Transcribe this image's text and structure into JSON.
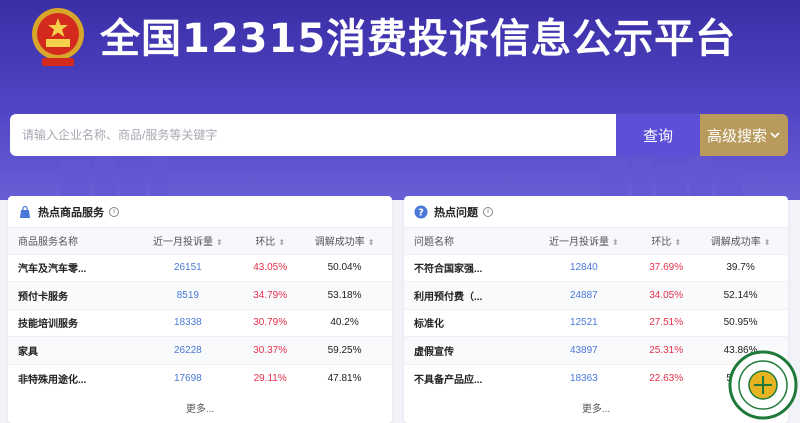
{
  "header": {
    "title": "全国12315消费投诉信息公示平台",
    "emblem_icon": "national-emblem-icon"
  },
  "search": {
    "placeholder": "请输入企业名称、商品/服务等关键字",
    "value": "",
    "search_label": "查询",
    "advanced_label": "高级搜索",
    "advanced_icon": "chevron-down-icon"
  },
  "colors": {
    "hero": "#4a3fbc",
    "search_button": "#5c4fd8",
    "advanced_button": "#b89a5c",
    "count": "#4a78d8",
    "ratio": "#e8304a"
  },
  "hot_goods": {
    "title": "热点商品服务",
    "icon": "shopping-bag-icon",
    "columns": [
      "商品服务名称",
      "近一月投诉量",
      "环比",
      "调解成功率"
    ],
    "rows": [
      {
        "name": "汽车及汽车零...",
        "count": "26151",
        "ratio": "43.05%",
        "rate": "50.04%"
      },
      {
        "name": "预付卡服务",
        "count": "8519",
        "ratio": "34.79%",
        "rate": "53.18%"
      },
      {
        "name": "技能培训服务",
        "count": "18338",
        "ratio": "30.79%",
        "rate": "40.2%"
      },
      {
        "name": "家具",
        "count": "26228",
        "ratio": "30.37%",
        "rate": "59.25%"
      },
      {
        "name": "非特殊用途化...",
        "count": "17698",
        "ratio": "29.11%",
        "rate": "47.81%"
      }
    ],
    "more_label": "更多..."
  },
  "hot_issues": {
    "title": "热点问题",
    "icon": "question-icon",
    "columns": [
      "问题名称",
      "近一月投诉量",
      "环比",
      "调解成功率"
    ],
    "rows": [
      {
        "name": "不符合国家强...",
        "count": "12840",
        "ratio": "37.69%",
        "rate": "39.7%"
      },
      {
        "name": "利用预付费（...",
        "count": "24887",
        "ratio": "34.05%",
        "rate": "52.14%"
      },
      {
        "name": "标准化",
        "count": "12521",
        "ratio": "27.51%",
        "rate": "50.95%"
      },
      {
        "name": "虚假宣传",
        "count": "43897",
        "ratio": "25.31%",
        "rate": "43.86%"
      },
      {
        "name": "不具备产品应...",
        "count": "18363",
        "ratio": "22.63%",
        "rate": "51.4%"
      }
    ],
    "more_label": "更多..."
  }
}
